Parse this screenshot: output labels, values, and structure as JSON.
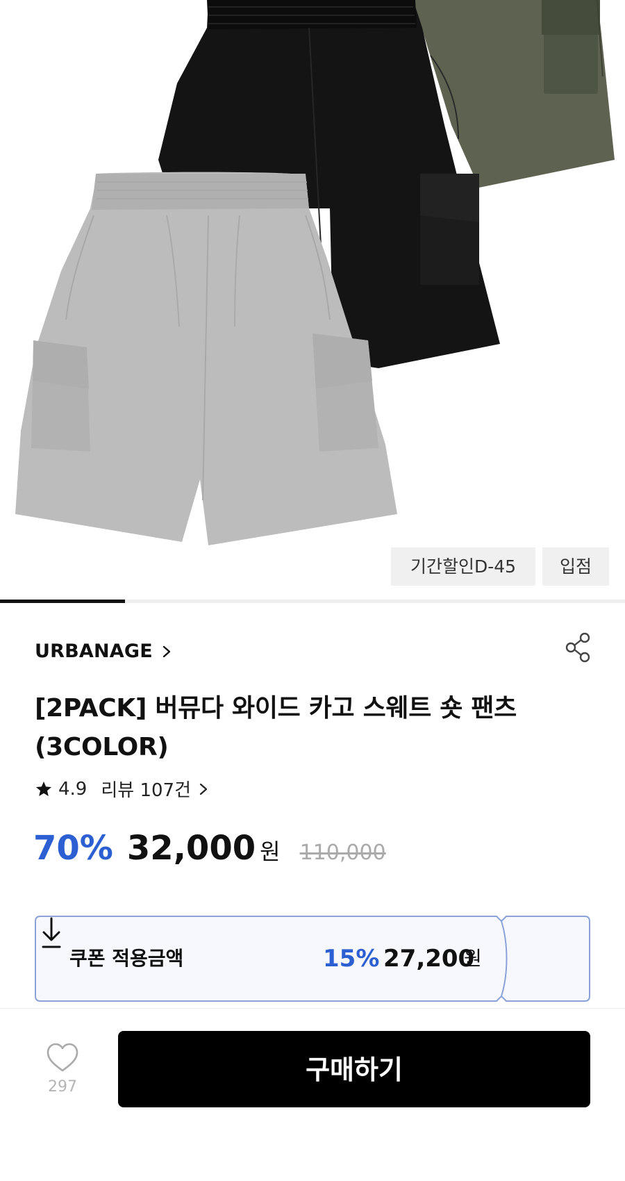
{
  "hero": {
    "tags": {
      "sale": "기간할인D-45",
      "store": "입점"
    },
    "carousel_progress": 0.2
  },
  "product": {
    "brand": "URBANAGE",
    "title": "[2PACK] 버뮤다 와이드 카고 스웨트 숏 팬츠 (3COLOR)",
    "rating": "4.9",
    "review_text": "리뷰 107건"
  },
  "price": {
    "discount": "70%",
    "price": "32,000",
    "currency": "원",
    "original": "110,000"
  },
  "coupon": {
    "label": "쿠폰 적용금액",
    "rate": "15%",
    "price": "27,200",
    "currency": "원"
  },
  "bottom_bar": {
    "like_count": "297",
    "buy_label": "구매하기"
  },
  "colors": {
    "accent_blue": "#2c5fd2",
    "coupon_border": "#8aa2d8",
    "coupon_bg": "#f6f8fd"
  },
  "icons": [
    "chevron-right-icon",
    "share-icon",
    "star-icon",
    "download-icon",
    "heart-icon"
  ]
}
